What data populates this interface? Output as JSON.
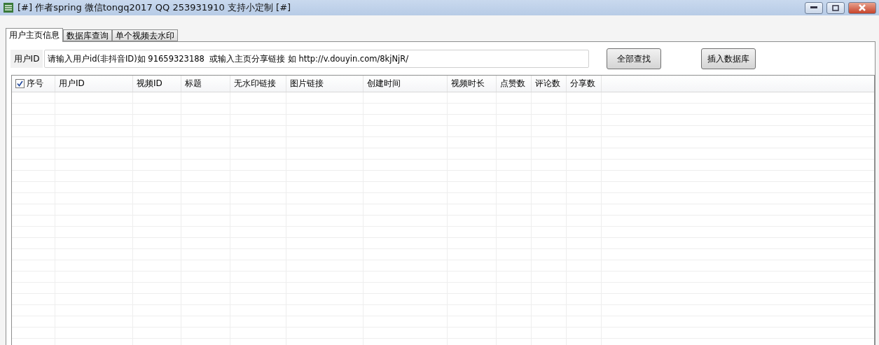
{
  "window": {
    "title": "[#] 作者spring 微信tongq2017  QQ 253931910 支持小定制 [#]"
  },
  "tabs": [
    {
      "label": "用户主页信息",
      "selected": true
    },
    {
      "label": "数据库查询",
      "selected": false
    },
    {
      "label": "单个视频去水印",
      "selected": false
    }
  ],
  "user_id": {
    "label": "用户ID",
    "value": "请输入用户id(非抖音ID)如 91659323188  或输入主页分享链接 如 http://v.douyin.com/8kjNjR/"
  },
  "buttons": [
    "全部查找",
    "插入数据库"
  ],
  "table": {
    "select_all_checked": true,
    "columns": [
      "序号",
      "用户ID",
      "视频ID",
      "标题",
      "无水印链接",
      "图片链接",
      "创建时间",
      "视频时长",
      "点赞数",
      "评论数",
      "分享数"
    ]
  }
}
